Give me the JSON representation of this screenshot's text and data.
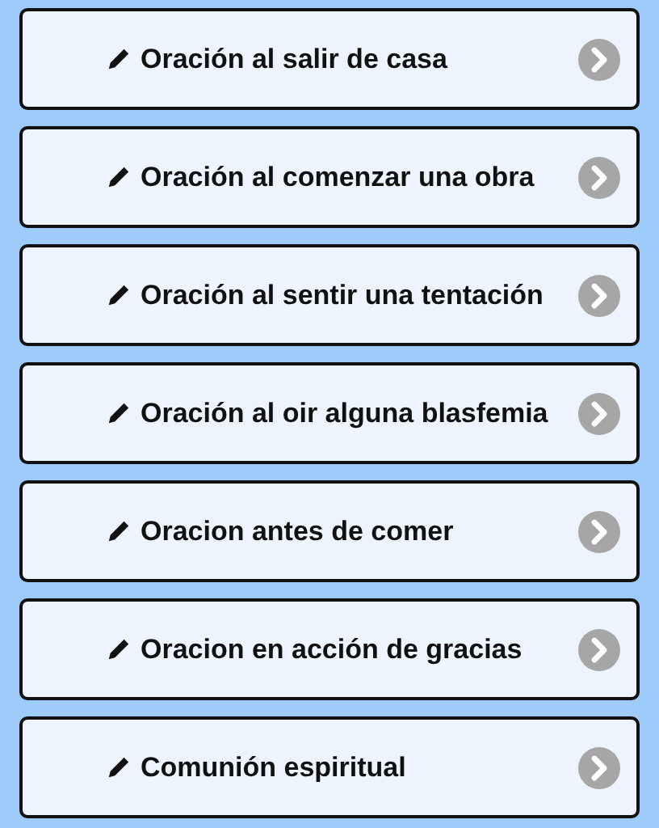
{
  "items": [
    {
      "label": "Oración al salir de casa"
    },
    {
      "label": "Oración al comenzar una obra"
    },
    {
      "label": "Oración al sentir una tentación"
    },
    {
      "label": "Oración al oir alguna blasfemia"
    },
    {
      "label": "Oracion antes de comer"
    },
    {
      "label": "Oracion en acción de gracias"
    },
    {
      "label": "Comunión espiritual"
    }
  ]
}
